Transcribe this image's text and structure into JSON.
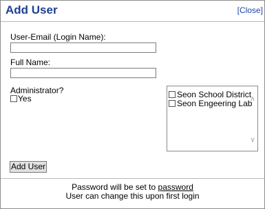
{
  "dialog": {
    "title": "Add User",
    "close_label": "[Close]"
  },
  "form": {
    "email_label": "User-Email (Login Name):",
    "email_value": "",
    "fullname_label": "Full Name:",
    "fullname_value": "",
    "admin_label": "Administrator?",
    "admin_yes_label": "Yes",
    "admin_checked": false
  },
  "groups": {
    "items": [
      {
        "label": "Seon School District",
        "checked": false
      },
      {
        "label": "Seon Engeering Lab",
        "checked": false
      }
    ]
  },
  "actions": {
    "add_user_label": "Add User"
  },
  "footer": {
    "line1_prefix": "Password will be set to ",
    "password_link": "password",
    "line2": "User can change this upon first login"
  },
  "colors": {
    "title": "#1f3f8f",
    "link": "#2244aa"
  }
}
